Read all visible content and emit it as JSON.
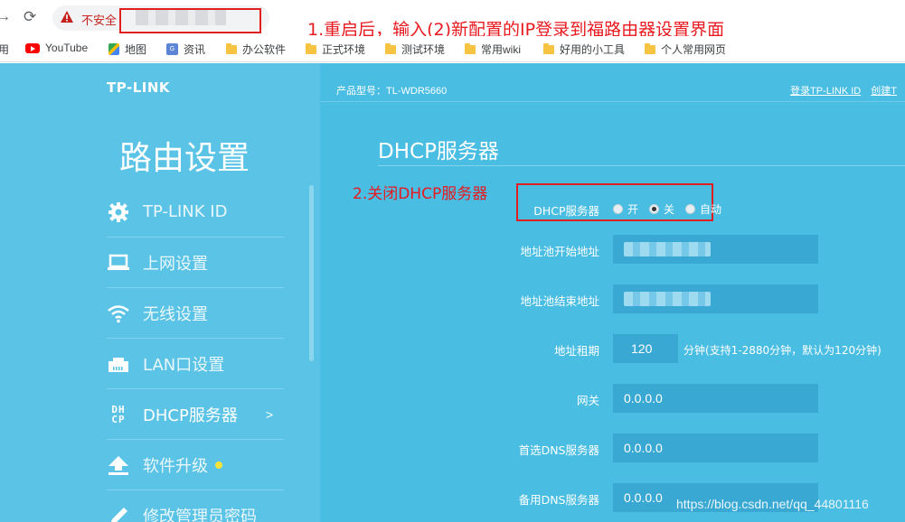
{
  "browser": {
    "security_label": "不安全",
    "bookmarks": [
      {
        "label": "用",
        "icon": "apps-icon"
      },
      {
        "label": "YouTube",
        "icon": "youtube-icon"
      },
      {
        "label": "地图",
        "icon": "maps-icon"
      },
      {
        "label": "资讯",
        "icon": "news-icon"
      },
      {
        "label": "办公软件",
        "icon": "folder-icon"
      },
      {
        "label": "正式环境",
        "icon": "folder-icon"
      },
      {
        "label": "测试环境",
        "icon": "folder-icon"
      },
      {
        "label": "常用wiki",
        "icon": "folder-icon"
      },
      {
        "label": "好用的小工具",
        "icon": "folder-icon"
      },
      {
        "label": "个人常用网页",
        "icon": "folder-icon"
      }
    ]
  },
  "annotations": {
    "step1": "1.重启后，输入(2)新配置的IP登录到福路由器设置界面",
    "step2": "2.关闭DHCP服务器",
    "color": "#e8191f"
  },
  "router": {
    "logo": "TP-LINK",
    "sidebar_title": "路由设置",
    "menu": [
      {
        "label": "TP-LINK ID",
        "icon": "gear-icon"
      },
      {
        "label": "上网设置",
        "icon": "laptop-icon"
      },
      {
        "label": "无线设置",
        "icon": "wifi-icon"
      },
      {
        "label": "LAN口设置",
        "icon": "lan-port-icon"
      },
      {
        "label": "DHCP服务器",
        "icon": "dhcp-icon",
        "arrow": ">"
      },
      {
        "label": "软件升级",
        "icon": "upload-icon"
      },
      {
        "label": "修改管理员密码",
        "icon": "pencil-icon"
      }
    ],
    "model": "产品型号：TL-WDR5660",
    "links": [
      "登录TP-LINK ID",
      "创建T"
    ],
    "page_heading": "DHCP服务器",
    "form": {
      "dhcp_label": "DHCP服务器",
      "options": [
        "开",
        "关",
        "自动"
      ],
      "selected": "关",
      "pool_start_label": "地址池开始地址",
      "pool_end_label": "地址池结束地址",
      "lease_label": "地址租期",
      "lease_value": "120",
      "lease_unit": "分钟(支持1-2880分钟，默认为120分钟)",
      "gateway_label": "网关",
      "gateway_value": "0.0.0.0",
      "dns1_label": "首选DNS服务器",
      "dns1_value": "0.0.0.0",
      "dns2_label": "备用DNS服务器",
      "dns2_value": "0.0.0.0"
    },
    "colors": {
      "sidebar": "#5bc4e6",
      "main": "#49bde2",
      "field": "#39a9d3"
    }
  },
  "watermark": "https://blog.csdn.net/qq_44801116"
}
